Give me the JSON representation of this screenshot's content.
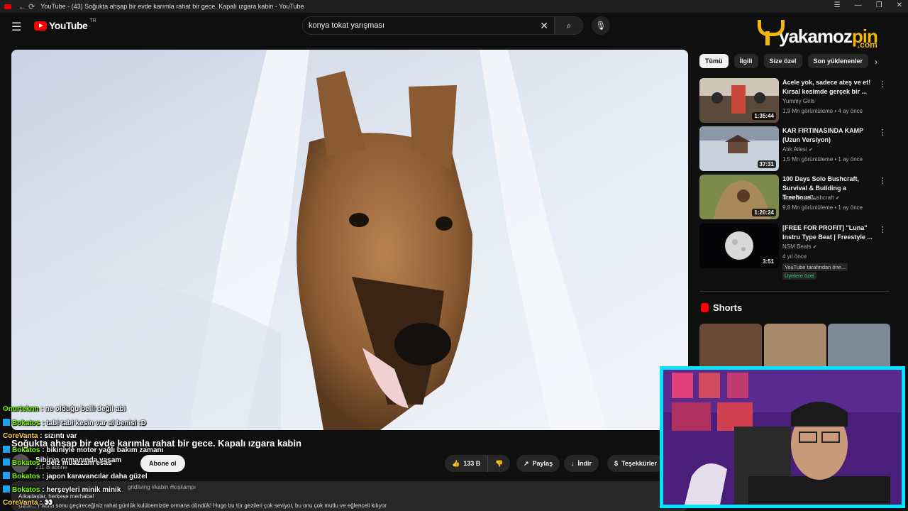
{
  "window": {
    "title": "YouTube - (43) Soğukta ahşap bir evde karımla rahat bir gece. Kapalı ızgara kabin - YouTube",
    "nav_icons": "← ⟳",
    "controls": [
      "☰",
      "—",
      "❐",
      "✕"
    ]
  },
  "masthead": {
    "menu_icon": "☰",
    "logo_text": "YouTube",
    "logo_country": "TR",
    "search_value": "konya tokat yarışması",
    "clear_icon": "✕",
    "search_icon": "⌕",
    "mic_icon": "🎙"
  },
  "brand": {
    "text_a": "yakamoz",
    "text_b": "pin",
    "dotcom": ".com"
  },
  "video": {
    "title": "Soğukta ahşap bir evde karımla rahat bir gece. Kapalı ızgara kabin",
    "channel": "Sibirya ormanında yaşam",
    "subscribers": "211 B abone",
    "subscribe_label": "Abone ol",
    "likes": "133 B",
    "share_label": "Paylaş",
    "download_label": "İndir",
    "thanks_label": "Teşekkürler",
    "description_tags": "gridliving #kabin #kışkampı",
    "description_line2": "Arkadaşlar, herkese merhaba!",
    "description_line3": "Uzun...  r hafta sonu geçireceğiniz rahat günlük kulübemizde ormana döndük! Hugo bu tür gezileri çok seviyor, bu onu çok mutlu ve eğlenceli kılıyor"
  },
  "chips": [
    "Tümü",
    "İlgili",
    "Size özel",
    "Son yüklenenler"
  ],
  "chip_next": "›",
  "recommendations": [
    {
      "title": "Acele yok, sadece ateş ve et! Kırsal kesimde gerçek bir ...",
      "channel": "Yummy Girls",
      "stats": "1,9 Mn görüntüleme • 4 ay önce",
      "duration": "1:35:44"
    },
    {
      "title": "KAR FIRTINASINDA KAMP (Uzun Versiyon)",
      "channel": "Atık Ailesi",
      "stats": "1,5 Mn görüntüleme • 1 ay önce",
      "duration": "37:31"
    },
    {
      "title": "100 Days Solo Bushcraft, Survival & Building a Treehous...",
      "channel": "Noru Saru Bushcraft",
      "stats": "9,8 Mn görüntüleme • 1 ay önce",
      "duration": "1:20:24"
    },
    {
      "title": "[FREE FOR PROFIT] \"Luna\" Instru Type Beat | Freestyle ...",
      "channel": "NSM Beats",
      "stats": "4 yıl önce",
      "duration": "3:51",
      "badge1": "YouTube tarafından öne...",
      "badge2": "Üyelere özel"
    }
  ],
  "shorts_heading": "Shorts",
  "chat": [
    {
      "user": "Onurteknn",
      "text": " : ne olduğu belli değil abi",
      "color": "green",
      "icon": false
    },
    {
      "user": "Bokatos",
      "text": " : tabi tabi kesin var al benisi :D",
      "color": "green",
      "icon": true
    },
    {
      "user": "CoreVanta",
      "text": " : sızıntı var",
      "color": "yellow",
      "icon": false
    },
    {
      "user": "Bokatos",
      "text": " : bikiniyle motor yağlı bakım zamanı",
      "color": "green",
      "icon": true
    },
    {
      "user": "Bokatos",
      "text": " : deiz muazzam esas",
      "color": "green",
      "icon": true
    },
    {
      "user": "Bokatos",
      "text": " : japon karavancılar daha güzel",
      "color": "green",
      "icon": true
    },
    {
      "user": "Bokatos",
      "text": " : herşeyleri minik minik",
      "color": "green",
      "icon": true
    },
    {
      "user": "CoreVanta",
      "text": " : 👀",
      "color": "yellow",
      "icon": false
    }
  ],
  "colors": {
    "background": "#0f0f0f",
    "youtube_red": "#ff0000",
    "brand_gold": "#f2b705",
    "cam_border": "#00e5ff"
  }
}
